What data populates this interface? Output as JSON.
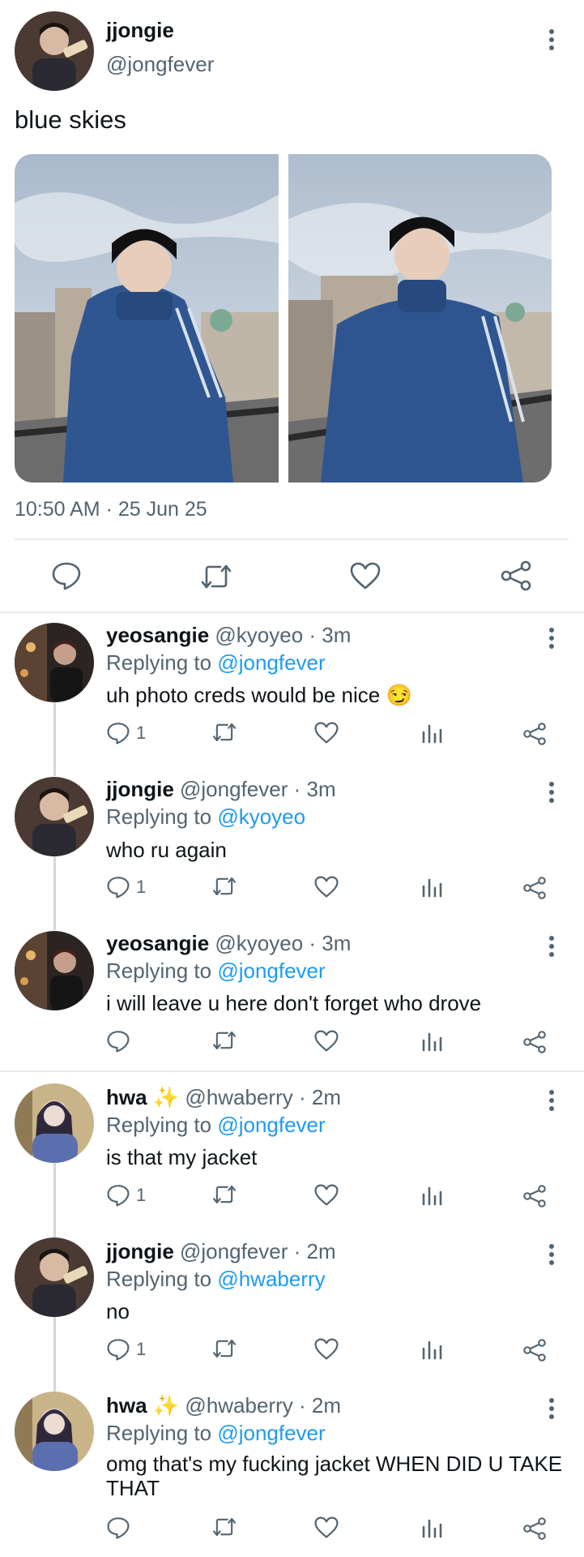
{
  "main_tweet": {
    "display_name": "jjongie",
    "handle": "@jongfever",
    "text": "blue skies",
    "timestamp": "10:50 AM · 25 Jun 25"
  },
  "replies": [
    {
      "display_name": "yeosangie",
      "handle": "@kyoyeo",
      "time": "· 3m",
      "replying_prefix": "Replying to",
      "replying_to": "@jongfever",
      "text": "uh photo creds would be nice",
      "emoji": "😏",
      "reply_count": "1"
    },
    {
      "display_name": "jjongie",
      "handle": "@jongfever",
      "time": "· 3m",
      "replying_prefix": "Replying to",
      "replying_to": "@kyoyeo",
      "text": "who ru again",
      "reply_count": "1"
    },
    {
      "display_name": "yeosangie",
      "handle": "@kyoyeo",
      "time": "· 3m",
      "replying_prefix": "Replying to",
      "replying_to": "@jongfever",
      "text": "i will leave u here don't forget who drove",
      "reply_count": ""
    },
    {
      "display_name": "hwa",
      "sparkle": "✨",
      "handle": "@hwaberry",
      "time": "· 2m",
      "replying_prefix": "Replying to",
      "replying_to": "@jongfever",
      "text": "is that my jacket",
      "reply_count": "1"
    },
    {
      "display_name": "jjongie",
      "handle": "@jongfever",
      "time": "· 2m",
      "replying_prefix": "Replying to",
      "replying_to": "@hwaberry",
      "text": "no",
      "reply_count": "1"
    },
    {
      "display_name": "hwa",
      "sparkle": "✨",
      "handle": "@hwaberry",
      "time": "· 2m",
      "replying_prefix": "Replying to",
      "replying_to": "@jongfever",
      "text": "omg that's my fucking jacket WHEN DID U TAKE THAT",
      "reply_count": ""
    }
  ],
  "colors": {
    "accent": "#1d9bf0",
    "secondary_text": "#536471",
    "divider": "#e8ebed"
  },
  "icons": [
    "reply-icon",
    "retweet-icon",
    "like-icon",
    "share-icon",
    "views-icon",
    "more-icon"
  ]
}
